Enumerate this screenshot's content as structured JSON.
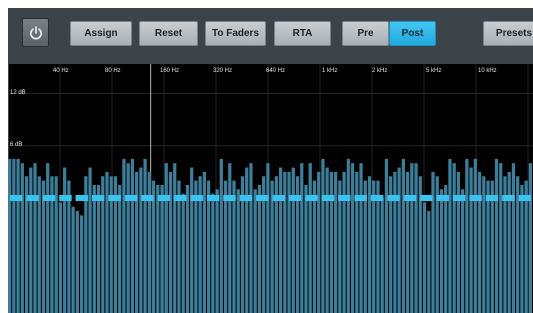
{
  "toolbar": {
    "power_icon": "power-icon",
    "buttons": [
      {
        "key": "assign",
        "label": "Assign",
        "active": false
      },
      {
        "key": "reset",
        "label": "Reset",
        "active": false
      },
      {
        "key": "to_faders",
        "label": "To Faders",
        "active": false
      },
      {
        "key": "rta",
        "label": "RTA",
        "active": false
      },
      {
        "key": "pre",
        "label": "Pre",
        "active": false
      },
      {
        "key": "post",
        "label": "Post",
        "active": true
      },
      {
        "key": "presets",
        "label": "Presets",
        "active": false
      }
    ]
  },
  "eq": {
    "freq_labels": [
      "40 Hz",
      "80 Hz",
      "160 Hz",
      "320 Hz",
      "640 Hz",
      "1 kHz",
      "2 kHz",
      "5 kHz",
      "10 kHz"
    ],
    "db_labels": [
      "12 dB",
      "6 dB"
    ],
    "colors": {
      "background": "#000000",
      "bar": "#3d7e9a",
      "fader_marker": "#38c4ee",
      "grid": "#3a3a3a"
    },
    "rta_levels_db": [
      4.5,
      4.5,
      4.5,
      4.0,
      2.5,
      3.5,
      4.0,
      2.5,
      2.0,
      4.0,
      2.5,
      2.5,
      -0.5,
      3.5,
      2.0,
      -1.0,
      -1.5,
      -2.0,
      2.5,
      3.5,
      1.5,
      1.5,
      2.5,
      3.0,
      2.5,
      2.5,
      1.5,
      4.5,
      4.0,
      4.5,
      3.0,
      3.5,
      4.5,
      3.0,
      2.0,
      1.5,
      1.5,
      4.0,
      3.0,
      4.0,
      2.0,
      0.5,
      1.5,
      3.5,
      2.0,
      2.5,
      3.0,
      2.0,
      0.5,
      1.0,
      4.5,
      2.0,
      4.0,
      2.0,
      1.0,
      2.5,
      3.5,
      4.0,
      1.0,
      1.5,
      2.5,
      4.0,
      2.0,
      2.5,
      3.5,
      3.0,
      3.0,
      3.5,
      2.5,
      4.0,
      1.5,
      4.0,
      2.0,
      3.0,
      4.5,
      3.5,
      3.0,
      3.0,
      2.0,
      3.0,
      4.5,
      4.0,
      3.0,
      4.0,
      2.0,
      2.5,
      2.0,
      2.0,
      0.0,
      4.5,
      2.5,
      3.0,
      3.5,
      4.5,
      3.0,
      4.0,
      4.0,
      2.5,
      -0.5,
      -1.5,
      3.0,
      2.5,
      1.0,
      1.5,
      4.5,
      4.0,
      3.0,
      1.0,
      4.5,
      3.5,
      4.5,
      3.0,
      2.5,
      2.0,
      2.0,
      4.5,
      4.0,
      2.5,
      3.0,
      4.0,
      2.5,
      1.5,
      2.0,
      4.0
    ],
    "fader_levels_db": [
      0,
      0,
      0,
      0,
      0,
      0,
      0,
      0,
      0,
      0,
      0,
      0,
      0,
      0,
      0,
      0,
      0,
      0,
      0,
      0,
      0,
      0,
      0,
      0,
      0,
      0,
      0,
      0,
      0,
      0,
      0,
      0
    ]
  }
}
